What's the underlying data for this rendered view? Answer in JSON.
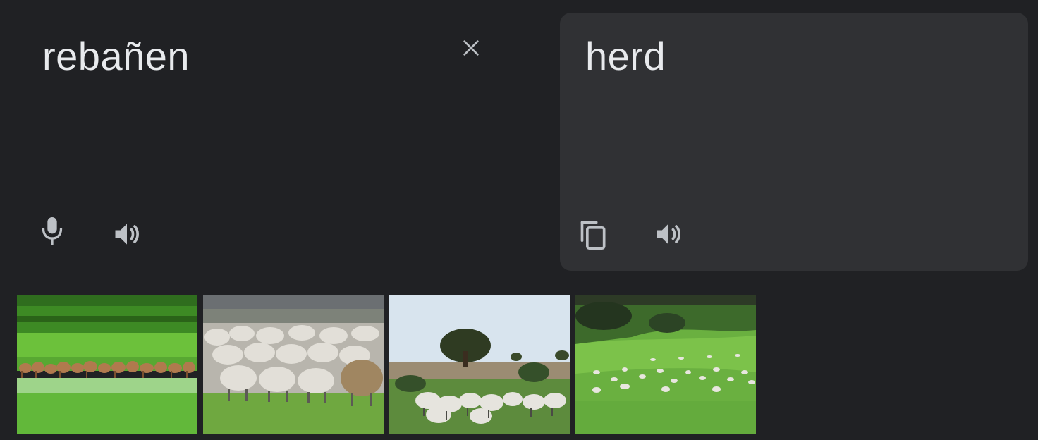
{
  "source": {
    "text": "rebañen"
  },
  "target": {
    "text": "herd"
  },
  "icons": {
    "clear": "close-icon",
    "mic": "microphone-icon",
    "source_speaker": "speaker-icon",
    "copy": "copy-icon",
    "target_speaker": "speaker-icon"
  },
  "images": [
    {
      "subject": "sheep-herd-image"
    },
    {
      "subject": "sheep-herd-image"
    },
    {
      "subject": "sheep-herd-image"
    },
    {
      "subject": "sheep-herd-image"
    }
  ],
  "colors": {
    "background": "#202124",
    "panel": "#303134",
    "text": "#e8eaed",
    "icon": "#bdc1c6"
  }
}
